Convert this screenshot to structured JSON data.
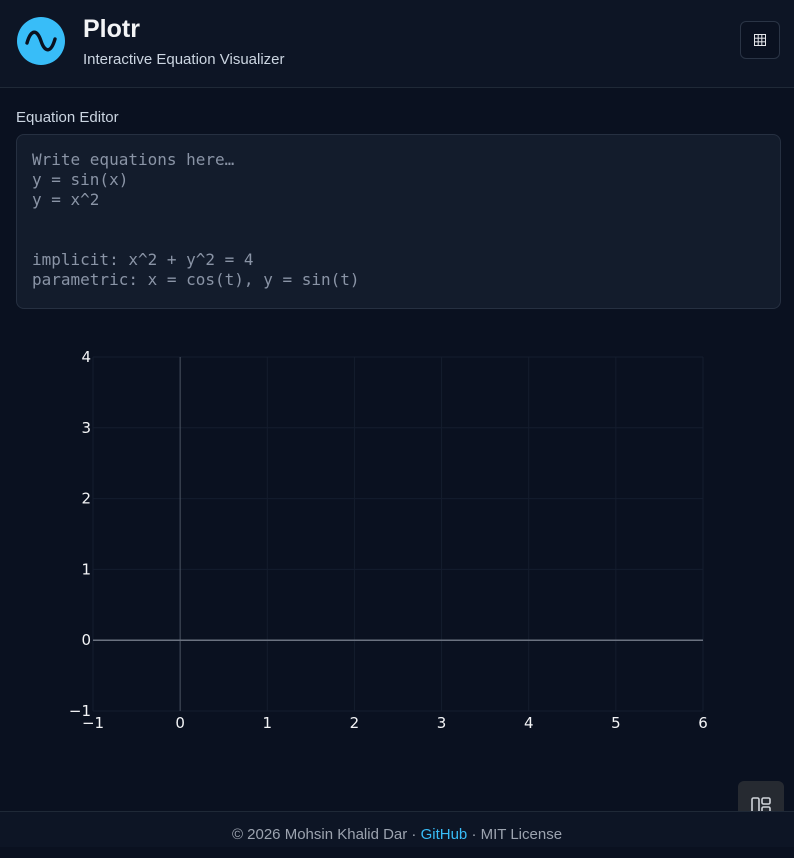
{
  "header": {
    "title": "Plotr",
    "subtitle": "Interactive Equation Visualizer",
    "logo_icon": "sine-wave-icon",
    "action_icon": "grid-icon"
  },
  "editor": {
    "label": "Equation Editor",
    "lines": [
      "Write equations here…",
      "y = sin(x)",
      "y = x^2",
      "",
      "implicit: x^2 + y^2 = 4",
      "parametric: x = cos(t), y = sin(t)"
    ]
  },
  "chart_data": {
    "type": "line",
    "series": [],
    "xlim": [
      -1,
      6
    ],
    "ylim": [
      -1,
      4
    ],
    "x_ticks": [
      -1,
      0,
      1,
      2,
      3,
      4,
      5,
      6
    ],
    "y_ticks": [
      -1,
      0,
      1,
      2,
      3,
      4
    ],
    "x_tick_labels": [
      "−1",
      "0",
      "1",
      "2",
      "3",
      "4",
      "5",
      "6"
    ],
    "y_tick_labels": [
      "−1",
      "0",
      "1",
      "2",
      "3",
      "4"
    ],
    "grid": true,
    "title": "",
    "xlabel": "",
    "ylabel": ""
  },
  "layout_toggle": {
    "icon": "layout-panels-icon"
  },
  "footer": {
    "copyright": "© 2026 Mohsin Khalid Dar · ",
    "link_label": "GitHub",
    "license": " · MIT License"
  },
  "colors": {
    "background": "#0a1120",
    "accent": "#38bdf8",
    "panel": "#131c2c"
  }
}
